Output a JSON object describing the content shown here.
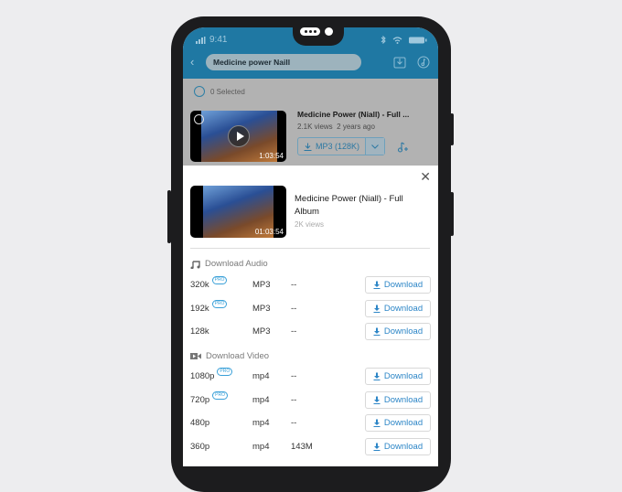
{
  "status_bar": {
    "time": "9:41"
  },
  "header": {
    "back_icon": "chevron-left-icon",
    "search_value": "Medicine power Naill",
    "download_icon": "download-tray-icon",
    "music_icon": "music-note-circle-icon"
  },
  "list": {
    "selected_label": "0 Selected",
    "item": {
      "title": "Medicine Power (Niall) - Full ...",
      "views": "2.1K views",
      "age": "2 years ago",
      "duration": "1:03:54",
      "format_button": "MP3 (128K)"
    }
  },
  "sheet": {
    "title": "Medicine Power (Niall) - Full Album",
    "views": "2K views",
    "duration": "01:03:54",
    "audio_section": "Download Audio",
    "video_section": "Download Video",
    "download_label": "Download",
    "pro_badge": "PRO",
    "audio": [
      {
        "quality": "320k",
        "pro": true,
        "format": "MP3",
        "size": "--"
      },
      {
        "quality": "192k",
        "pro": true,
        "format": "MP3",
        "size": "--"
      },
      {
        "quality": "128k",
        "pro": false,
        "format": "MP3",
        "size": "--"
      }
    ],
    "video": [
      {
        "quality": "1080p",
        "pro": true,
        "format": "mp4",
        "size": "--"
      },
      {
        "quality": "720p",
        "pro": true,
        "format": "mp4",
        "size": "--"
      },
      {
        "quality": "480p",
        "pro": false,
        "format": "mp4",
        "size": "--"
      },
      {
        "quality": "360p",
        "pro": false,
        "format": "mp4",
        "size": "143M"
      }
    ]
  },
  "colors": {
    "header": "#1f78a3",
    "accent": "#2d86c7",
    "overlay": "#b2b2b2"
  }
}
